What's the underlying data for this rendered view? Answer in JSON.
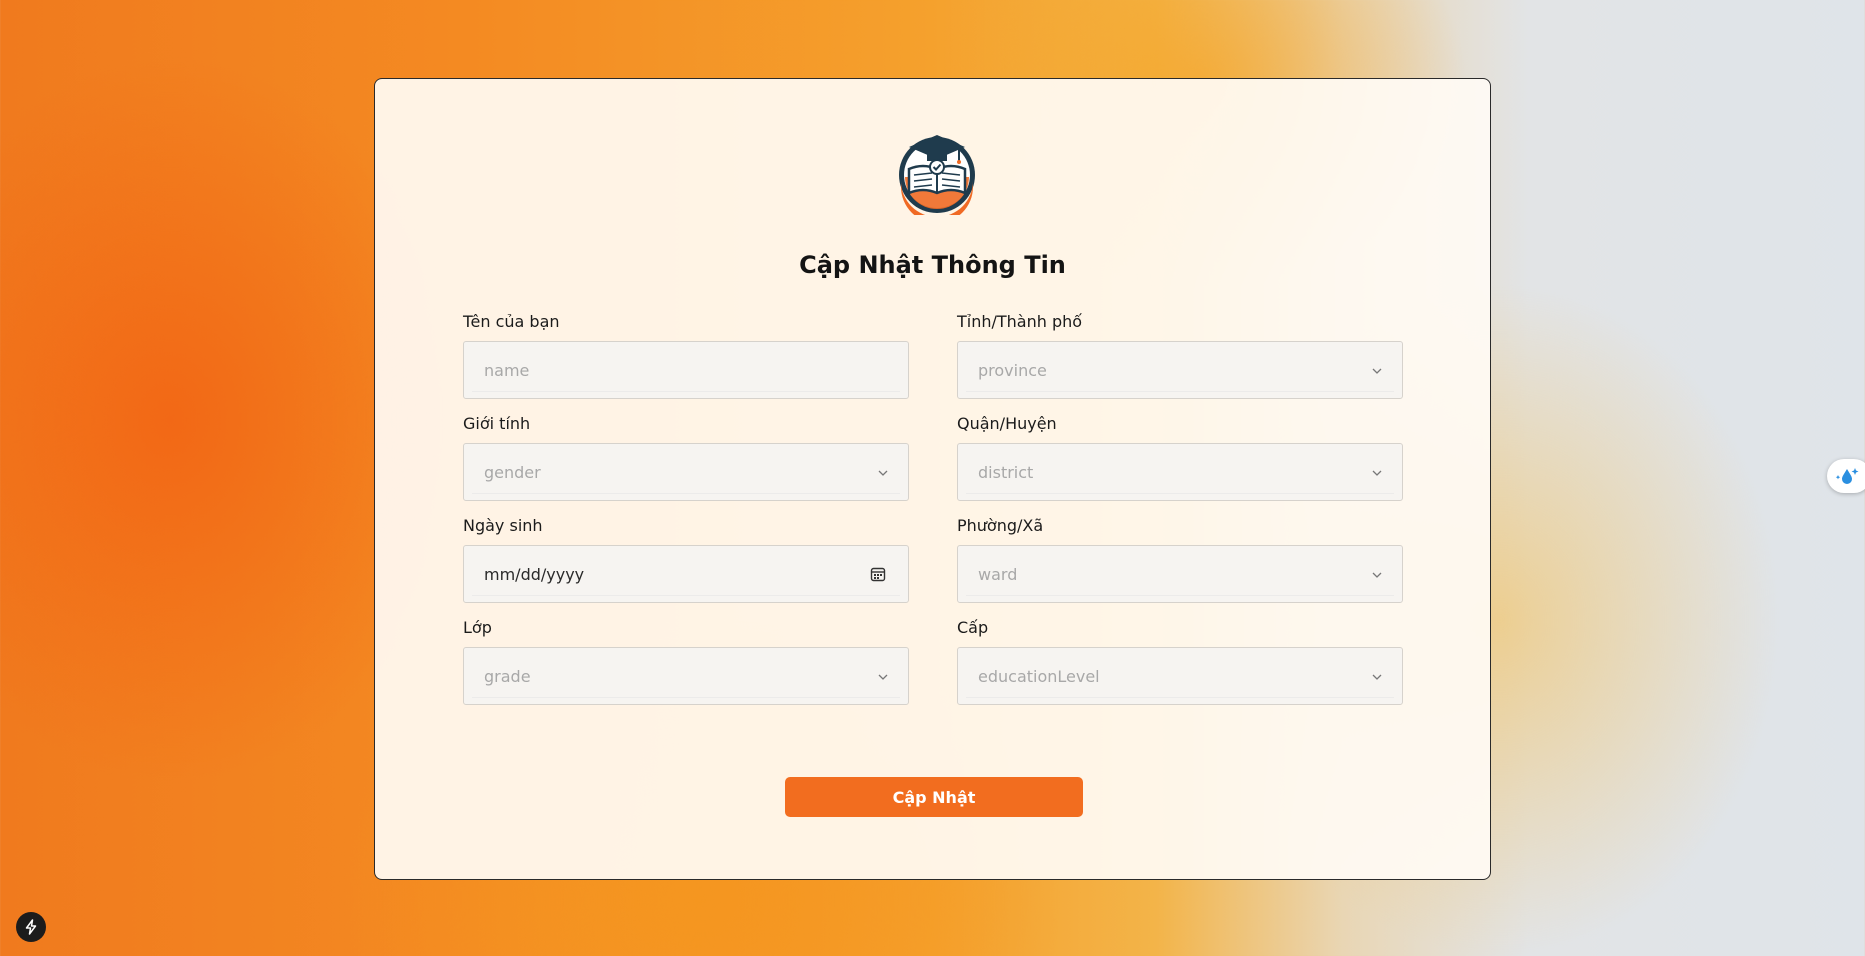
{
  "form": {
    "title": "Cập Nhật Thông Tin",
    "submit_label": "Cập Nhật",
    "fields": {
      "name": {
        "label": "Tên của bạn",
        "placeholder": "name"
      },
      "province": {
        "label": "Tỉnh/Thành phố",
        "placeholder": "province"
      },
      "gender": {
        "label": "Giới tính",
        "placeholder": "gender"
      },
      "district": {
        "label": "Quận/Huyện",
        "placeholder": "district"
      },
      "birthday": {
        "label": "Ngày sinh",
        "value": "mm/dd/yyyy"
      },
      "ward": {
        "label": "Phường/Xã",
        "placeholder": "ward"
      },
      "grade": {
        "label": "Lớp",
        "placeholder": "grade"
      },
      "education_level": {
        "label": "Cấp",
        "placeholder": "educationLevel"
      }
    }
  },
  "icons": {
    "logo": "graduation-book-logo",
    "select": "chevron-down-icon",
    "date": "calendar-icon",
    "side_widget": "water-drop-sparkle-icon",
    "corner": "lightning-bolt-icon"
  },
  "colors": {
    "accent": "#f26d1f",
    "card_background": "#fffbf4",
    "input_background": "#f6f4f1",
    "placeholder": "#a8a8a8"
  }
}
